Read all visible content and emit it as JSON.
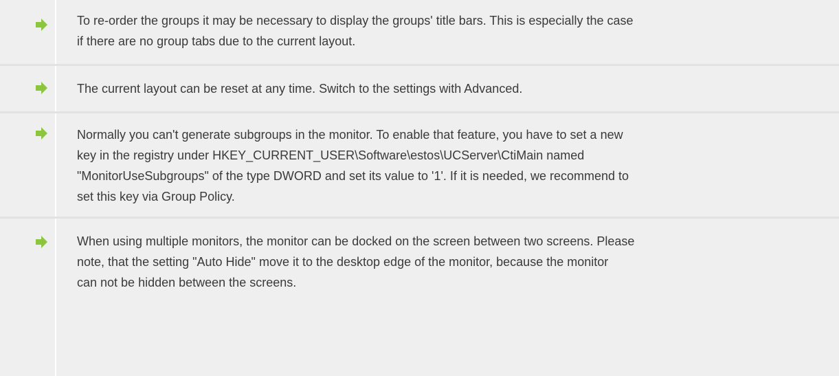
{
  "arrow_color": "#8cc63f",
  "icon": "arrow-right-icon",
  "notes": [
    {
      "lines": [
        "To re-order the groups it may be necessary to display the groups' title bars. This is especially the case",
        "if there are no group tabs due to the current layout."
      ]
    },
    {
      "lines": [
        "The current layout can be reset at any time. Switch to the settings with Advanced."
      ]
    },
    {
      "lines": [
        "Normally you can't generate subgroups in the monitor. To enable that feature, you have to set a new",
        "key in the registry under HKEY_CURRENT_USER\\Software\\estos\\UCServer\\CtiMain named",
        "\"MonitorUseSubgroups\" of the type DWORD and set its value to '1'. If it is needed, we recommend to",
        "set this key via Group Policy."
      ]
    },
    {
      "lines": [
        "When using multiple monitors, the monitor can be docked on the screen between two screens. Please",
        "note, that the setting \"Auto Hide\" move it to the desktop edge of the monitor, because the monitor",
        "can not be hidden between the screens."
      ]
    }
  ]
}
